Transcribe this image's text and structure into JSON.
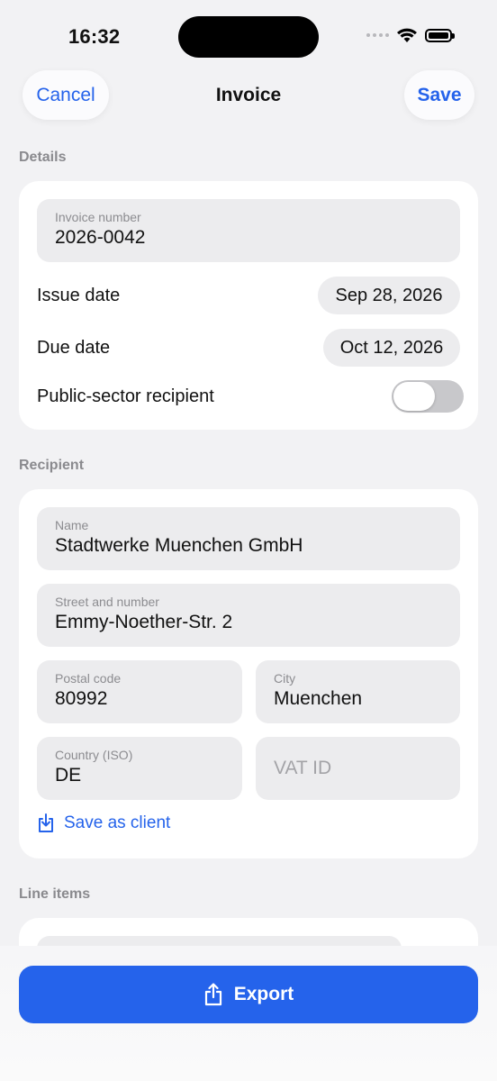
{
  "status_bar": {
    "time": "16:32"
  },
  "nav": {
    "cancel_label": "Cancel",
    "title": "Invoice",
    "save_label": "Save"
  },
  "details": {
    "section_label": "Details",
    "invoice_number_label": "Invoice number",
    "invoice_number_value": "2026-0042",
    "issue_date_label": "Issue date",
    "issue_date_value": "Sep 28, 2026",
    "due_date_label": "Due date",
    "due_date_value": "Oct 12, 2026",
    "public_sector_label": "Public-sector recipient",
    "public_sector_on": false
  },
  "recipient": {
    "section_label": "Recipient",
    "name_label": "Name",
    "name_value": "Stadtwerke Muenchen GmbH",
    "street_label": "Street and number",
    "street_value": "Emmy-Noether-Str. 2",
    "postal_label": "Postal code",
    "postal_value": "80992",
    "city_label": "City",
    "city_value": "Muenchen",
    "country_label": "Country (ISO)",
    "country_value": "DE",
    "vat_placeholder": "VAT ID",
    "save_client_label": "Save as client"
  },
  "line_items": {
    "section_label": "Line items"
  },
  "footer": {
    "export_label": "Export"
  },
  "colors": {
    "accent": "#2563eb",
    "background": "#f2f2f4",
    "field": "#ececee"
  }
}
